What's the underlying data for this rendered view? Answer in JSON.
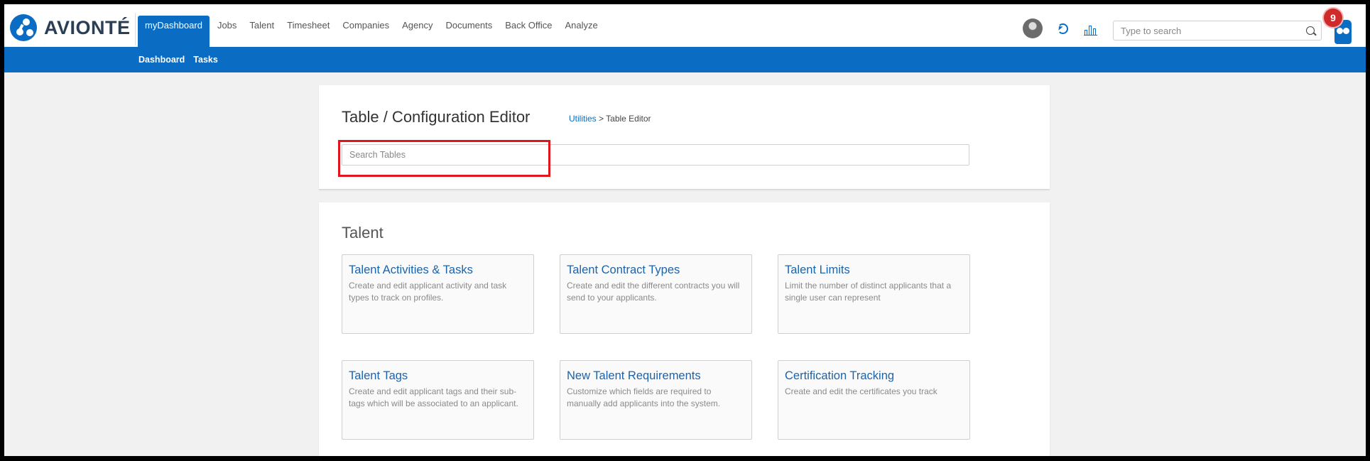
{
  "header": {
    "logo_text": "AVIONTÉ",
    "nav": [
      "myDashboard",
      "Jobs",
      "Talent",
      "Timesheet",
      "Companies",
      "Agency",
      "Documents",
      "Back Office",
      "Analyze"
    ],
    "search_placeholder": "Type to search",
    "notification_count": "9"
  },
  "subnav": [
    "Dashboard",
    "Tasks"
  ],
  "editor": {
    "title": "Table / Configuration Editor",
    "breadcrumb_link": "Utilities",
    "breadcrumb_sep": ">",
    "breadcrumb_current": "Table Editor",
    "search_placeholder": "Search Tables"
  },
  "talent_section": {
    "title": "Talent",
    "tiles": [
      {
        "title": "Talent Activities & Tasks",
        "desc": "Create and edit applicant activity and task types to track on profiles."
      },
      {
        "title": "Talent Contract Types",
        "desc": "Create and edit the different contracts you will send to your applicants."
      },
      {
        "title": "Talent Limits",
        "desc": "Limit the number of distinct applicants that a single user can represent"
      },
      {
        "title": "Talent Tags",
        "desc": "Create and edit applicant tags and their sub-tags which will be associated to an applicant."
      },
      {
        "title": "New Talent Requirements",
        "desc": "Customize which fields are required to manually add applicants into the system."
      },
      {
        "title": "Certification Tracking",
        "desc": "Create and edit the certificates you track"
      }
    ]
  },
  "colors": {
    "brand": "#0a6cc3",
    "highlight": "#e0161e",
    "badge": "#d02b2b"
  },
  "icons": [
    "logo-icon",
    "avatar",
    "refresh-icon",
    "chart-icon",
    "search-icon",
    "owl-notification-icon"
  ]
}
